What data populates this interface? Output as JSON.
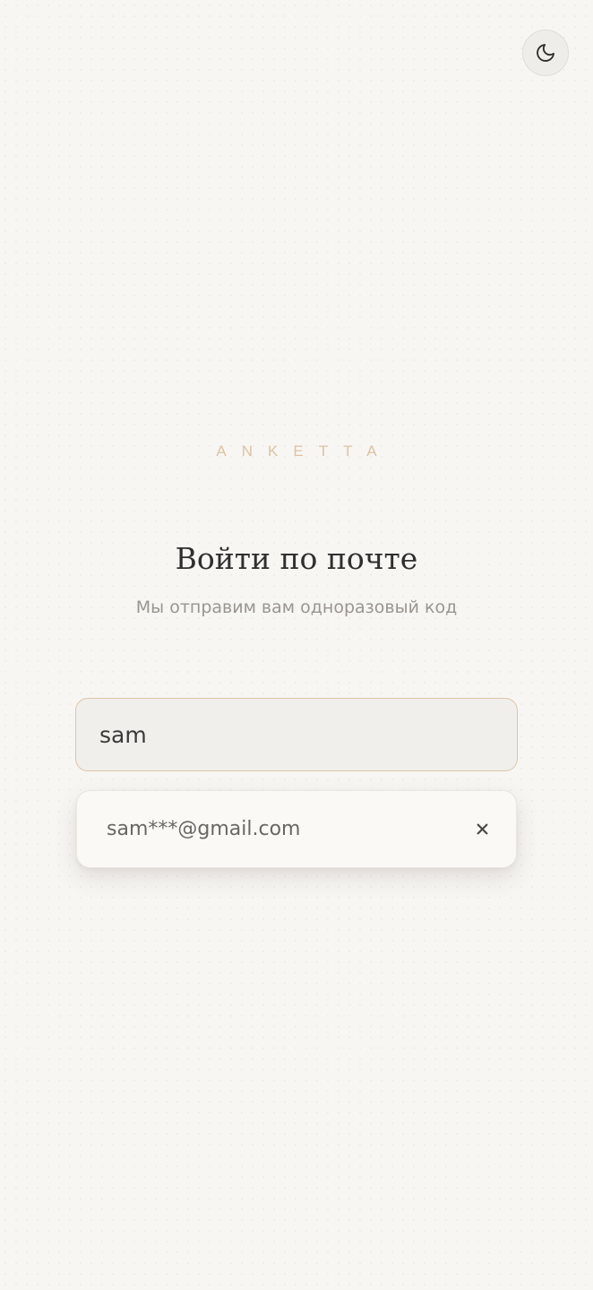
{
  "header": {
    "theme_toggle_icon": "moon-icon"
  },
  "brand": {
    "name": "ANKETTA",
    "color": "#dcc3a4"
  },
  "login": {
    "title": "Войти по почте",
    "subtitle": "Мы отправим вам одноразовый код",
    "email_value": "sam",
    "email_placeholder": ""
  },
  "autocomplete": {
    "suggestions": [
      {
        "email": "sam***@gmail.com",
        "remove_icon": "close-icon"
      }
    ]
  },
  "colors": {
    "background": "#f8f6f3",
    "accent": "#ddc4a6",
    "text": "#2f2f2f",
    "muted": "#9a958f"
  }
}
